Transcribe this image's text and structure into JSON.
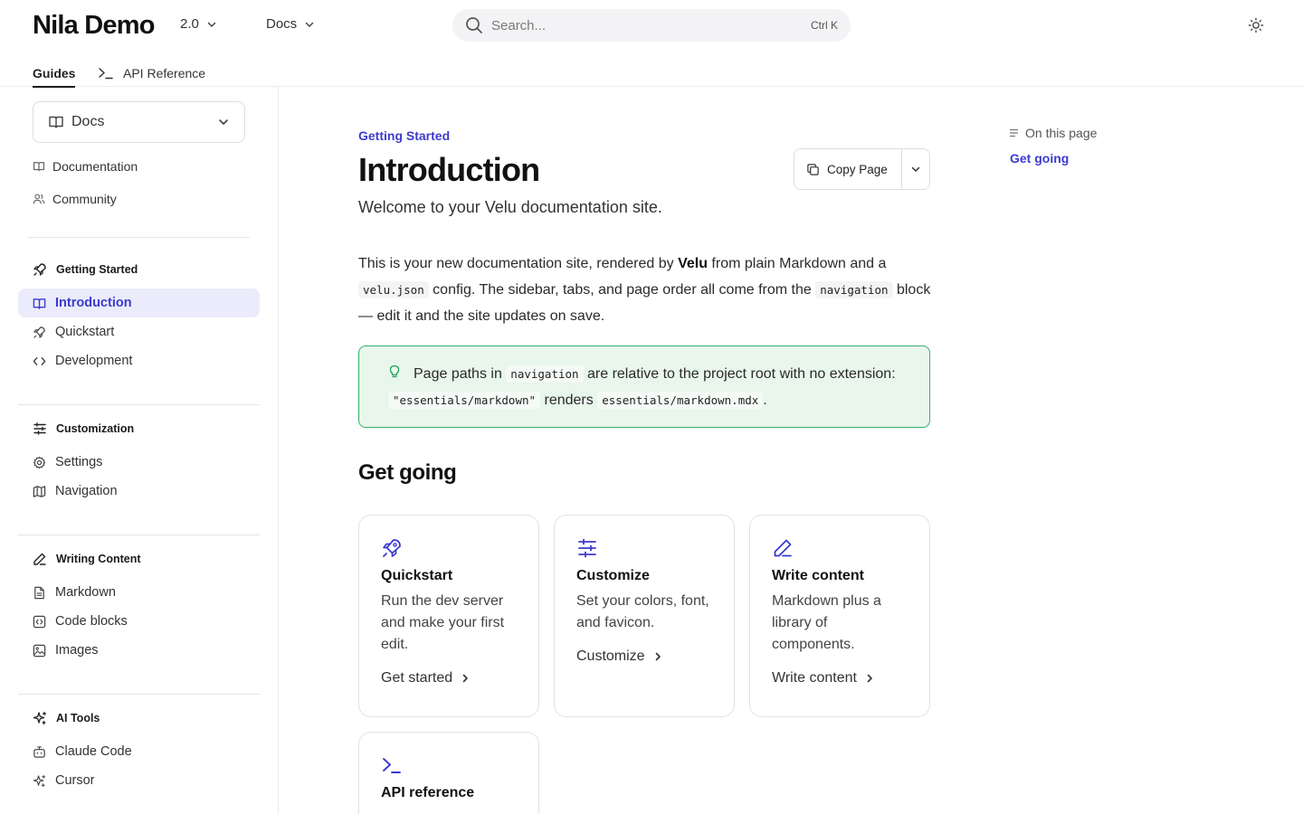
{
  "header": {
    "logo": "Nila Demo",
    "version": "2.0",
    "docs_menu": "Docs",
    "search_placeholder": "Search...",
    "search_shortcut": "Ctrl K"
  },
  "tabs": [
    {
      "label": "Guides",
      "active": true
    },
    {
      "label": "API Reference",
      "active": false
    }
  ],
  "sidebar": {
    "section_dropdown": "Docs",
    "top_links": [
      {
        "label": "Documentation",
        "icon": "book-icon"
      },
      {
        "label": "Community",
        "icon": "users-icon"
      }
    ],
    "groups": [
      {
        "title": "Getting Started",
        "icon": "rocket-icon",
        "items": [
          {
            "label": "Introduction",
            "icon": "book-open-icon",
            "active": true
          },
          {
            "label": "Quickstart",
            "icon": "rocket-icon"
          },
          {
            "label": "Development",
            "icon": "code-icon"
          }
        ]
      },
      {
        "title": "Customization",
        "icon": "sliders-icon",
        "items": [
          {
            "label": "Settings",
            "icon": "gear-icon"
          },
          {
            "label": "Navigation",
            "icon": "map-icon"
          }
        ]
      },
      {
        "title": "Writing Content",
        "icon": "pencil-icon",
        "items": [
          {
            "label": "Markdown",
            "icon": "file-text-icon"
          },
          {
            "label": "Code blocks",
            "icon": "code-square-icon"
          },
          {
            "label": "Images",
            "icon": "image-icon"
          }
        ]
      },
      {
        "title": "AI Tools",
        "icon": "sparkles-icon",
        "items": [
          {
            "label": "Claude Code",
            "icon": "bot-icon"
          },
          {
            "label": "Cursor",
            "icon": "sparkles-icon"
          }
        ]
      }
    ]
  },
  "page": {
    "eyebrow": "Getting Started",
    "title": "Introduction",
    "subtitle": "Welcome to your Velu documentation site.",
    "copy_button": "Copy Page",
    "intro": {
      "t1": "This is your new documentation site, rendered by ",
      "bold": "Velu",
      "t2": " from plain Markdown and a ",
      "code1": "velu.json",
      "t3": " config. The sidebar, tabs, and page order all come from the ",
      "code2": "navigation",
      "t4": " block — edit it and the site updates on save."
    },
    "callout": {
      "t1": "Page paths in ",
      "code1": "navigation",
      "t2": " are relative to the project root with no extension: ",
      "code2": "\"essentials/markdown\"",
      "t3": " renders ",
      "code3": "essentials/markdown.mdx",
      "t4": "."
    },
    "section_heading": "Get going",
    "cards": [
      {
        "title": "Quickstart",
        "description": "Run the dev server and make your first edit.",
        "link": "Get started",
        "icon": "rocket-icon"
      },
      {
        "title": "Customize",
        "description": "Set your colors, font, and favicon.",
        "link": "Customize",
        "icon": "sliders-icon"
      },
      {
        "title": "Write content",
        "description": "Markdown plus a library of components.",
        "link": "Write content",
        "icon": "pen-icon"
      },
      {
        "title": "API reference",
        "description": "",
        "link": "",
        "icon": "terminal-icon"
      }
    ]
  },
  "toc": {
    "heading": "On this page",
    "items": [
      "Get going"
    ]
  },
  "colors": {
    "accent": "#3b3bcf",
    "active_bg": "#ebebfb",
    "callout_border": "#36b06a",
    "callout_bg": "#e8f6ec"
  }
}
